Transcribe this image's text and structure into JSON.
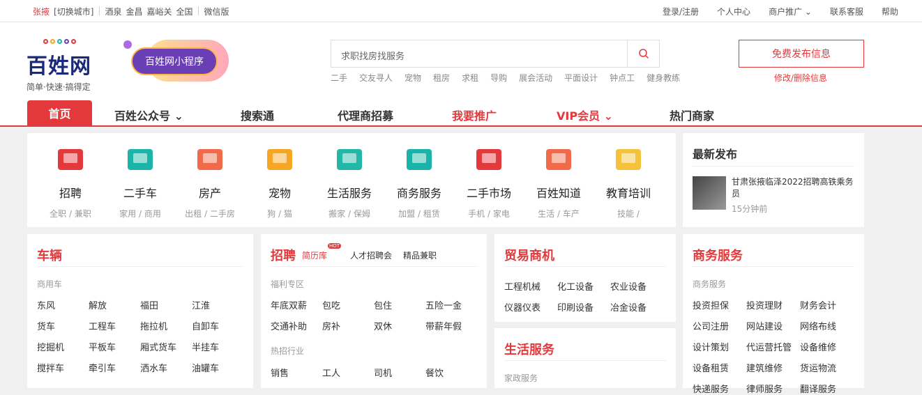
{
  "topbar": {
    "city": "张掖",
    "switch": "[切换城市]",
    "cities": [
      "酒泉",
      "金昌",
      "嘉峪关",
      "全国"
    ],
    "wechat": "微信版",
    "right": [
      "登录/注册",
      "个人中心",
      "商户推广",
      "联系客服",
      "帮助"
    ]
  },
  "logo": {
    "title": "百姓网",
    "slogan": "简单·快速·搞得定"
  },
  "mini": "百姓网小程序",
  "search": {
    "placeholder": "求职找房找服务",
    "hot": [
      "二手",
      "交友寻人",
      "宠物",
      "租房",
      "求租",
      "导购",
      "展会活动",
      "平面设计",
      "钟点工",
      "健身教练"
    ]
  },
  "publish": "免费发布信息",
  "edit": "修改/删除信息",
  "nav": [
    "首页",
    "百姓公众号",
    "搜索通",
    "代理商招募",
    "我要推广",
    "VIP会员",
    "热门商家"
  ],
  "cats": [
    {
      "n": "招聘",
      "d": "全职 / 兼职",
      "c": "#e4393c"
    },
    {
      "n": "二手车",
      "d": "家用 / 商用",
      "c": "#1ab5a8"
    },
    {
      "n": "房产",
      "d": "出租 / 二手房",
      "c": "#f06b4b"
    },
    {
      "n": "宠物",
      "d": "狗 / 猫",
      "c": "#f5a623"
    },
    {
      "n": "生活服务",
      "d": "搬家 / 保姆",
      "c": "#22b7a6"
    },
    {
      "n": "商务服务",
      "d": "加盟 / 租赁",
      "c": "#19b3a9"
    },
    {
      "n": "二手市场",
      "d": "手机 / 家电",
      "c": "#e4393c"
    },
    {
      "n": "百姓知道",
      "d": "生活 / 车产",
      "c": "#f06b4b"
    },
    {
      "n": "教育培训",
      "d": "技能 /",
      "c": "#f5c23b"
    }
  ],
  "latest": {
    "title": "最新发布",
    "item": "甘肃张掖临泽2022招聘高铁乘务员",
    "time": "15分钟前"
  },
  "boxes": {
    "vehicle": {
      "title": "车辆",
      "sub": "商用车",
      "items": [
        "东风",
        "解放",
        "福田",
        "江淮",
        "货车",
        "工程车",
        "拖拉机",
        "自卸车",
        "挖掘机",
        "平板车",
        "厢式货车",
        "半挂车",
        "搅拌车",
        "牵引车",
        "洒水车",
        "油罐车"
      ]
    },
    "job": {
      "title": "招聘",
      "tags": [
        "简历库",
        "人才招聘会",
        "精品兼职"
      ],
      "hot": "HOT",
      "sub1": "福利专区",
      "items1": [
        "年底双薪",
        "包吃",
        "包住",
        "五险一金",
        "交通补助",
        "房补",
        "双休",
        "带薪年假"
      ],
      "sub2": "热招行业",
      "items2": [
        "销售",
        "工人",
        "司机",
        "餐饮"
      ]
    },
    "trade": {
      "title": "贸易商机",
      "items": [
        "工程机械",
        "化工设备",
        "农业设备",
        "仪器仪表",
        "印刷设备",
        "冶金设备"
      ]
    },
    "life": {
      "title": "生活服务",
      "sub": "家政服务"
    },
    "biz": {
      "title": "商务服务",
      "sub": "商务服务",
      "items": [
        "投资担保",
        "投资理财",
        "财务会计",
        "公司注册",
        "网站建设",
        "网络布线",
        "设计策划",
        "代运营托管",
        "设备维修",
        "设备租赁",
        "建筑维修",
        "货运物流",
        "快递服务",
        "律师服务",
        "翻译服务"
      ]
    }
  }
}
